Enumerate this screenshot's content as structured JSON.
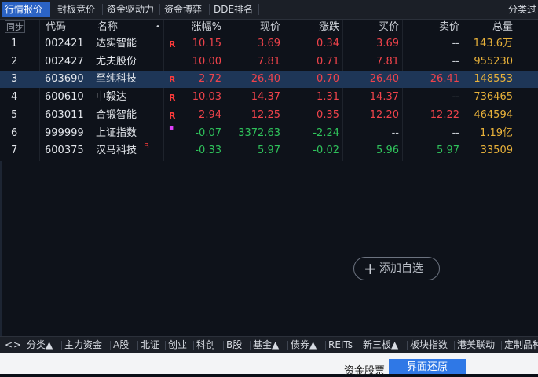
{
  "top_tabs": [
    {
      "label": "行情报价",
      "active": true
    },
    {
      "label": "封板竞价",
      "active": false
    },
    {
      "label": "资金驱动力",
      "active": false
    },
    {
      "label": "资金博弈",
      "active": false
    },
    {
      "label": "DDE排名",
      "active": false
    }
  ],
  "top_right_label": "分类过",
  "sync_label": "同步",
  "columns": {
    "code": "代码",
    "name": "名称",
    "dot": "•",
    "change_pct": "涨幅%",
    "price": "现价",
    "change": "涨跌",
    "bid": "买价",
    "ask": "卖价",
    "volume": "总量"
  },
  "rows": [
    {
      "idx": "1",
      "code": "002421",
      "name": "达实智能",
      "flag": "R",
      "sup": "",
      "change_pct": "10.15",
      "price": "3.69",
      "change": "0.34",
      "bid": "3.69",
      "ask": "--",
      "volume": "143.6万",
      "trend": "up",
      "selected": false
    },
    {
      "idx": "2",
      "code": "002427",
      "name": "尤夫股份",
      "flag": "",
      "sup": "",
      "change_pct": "10.00",
      "price": "7.81",
      "change": "0.71",
      "bid": "7.81",
      "ask": "--",
      "volume": "955230",
      "trend": "up",
      "selected": false
    },
    {
      "idx": "3",
      "code": "603690",
      "name": "至纯科技",
      "flag": "R",
      "sup": "",
      "change_pct": "2.72",
      "price": "26.40",
      "change": "0.70",
      "bid": "26.40",
      "ask": "26.41",
      "volume": "148553",
      "trend": "up",
      "selected": true
    },
    {
      "idx": "4",
      "code": "600610",
      "name": "中毅达",
      "flag": "R",
      "sup": "",
      "change_pct": "10.03",
      "price": "14.37",
      "change": "1.31",
      "bid": "14.37",
      "ask": "--",
      "volume": "736465",
      "trend": "up",
      "selected": false
    },
    {
      "idx": "5",
      "code": "603011",
      "name": "合锻智能",
      "flag": "R",
      "sup": "",
      "change_pct": "2.94",
      "price": "12.25",
      "change": "0.35",
      "bid": "12.20",
      "ask": "12.22",
      "volume": "464594",
      "trend": "up",
      "selected": false
    },
    {
      "idx": "6",
      "code": "999999",
      "name": "上证指数",
      "flag": "",
      "sup": "",
      "change_pct": "-0.07",
      "price": "3372.63",
      "change": "-2.24",
      "bid": "--",
      "ask": "--",
      "volume": "1.19亿",
      "trend": "down",
      "selected": false
    },
    {
      "idx": "7",
      "code": "600375",
      "name": "汉马科技",
      "flag": "",
      "sup": "B",
      "change_pct": "-0.33",
      "price": "5.97",
      "change": "-0.02",
      "bid": "5.96",
      "ask": "5.97",
      "volume": "33509",
      "trend": "down",
      "selected": false
    }
  ],
  "add_favorite_label": "添加自选",
  "bottom_tabs": [
    "<",
    ">",
    "分类▲",
    "主力资金",
    "A股",
    "北证",
    "创业",
    "科创",
    "B股",
    "基金▲",
    "债券▲",
    "REITs",
    "新三板▲",
    "板块指数",
    "港美联动",
    "定制品种"
  ],
  "footer": {
    "fund_label": "资金股票",
    "restore_label": "界面还原"
  },
  "colors": {
    "up": "#f0434b",
    "down": "#2fc25b",
    "volume": "#e9b23a",
    "active_tab": "#2b63c5",
    "selected_row": "#1e3657"
  }
}
